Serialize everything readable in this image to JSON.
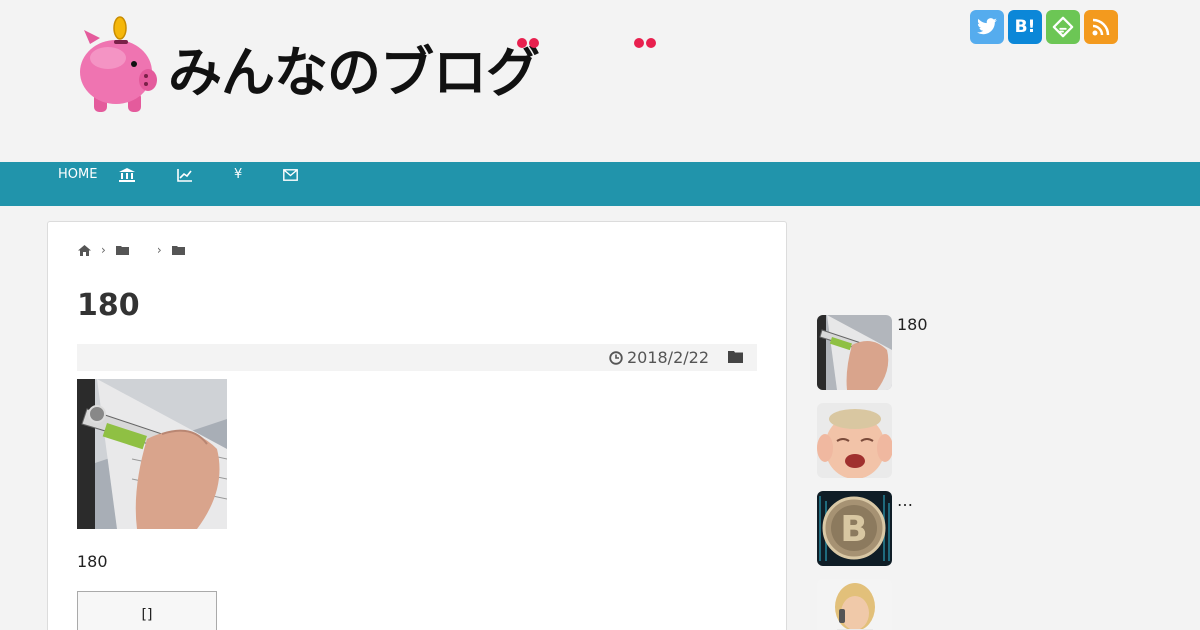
{
  "header": {
    "logo_text": "みんなのブログ",
    "social": [
      {
        "name": "twitter-icon",
        "glyph": "",
        "color": "#55acee"
      },
      {
        "name": "hatena-bookmark-icon",
        "glyph": "B!",
        "color": "#0b87d8"
      },
      {
        "name": "feedly-icon",
        "glyph": "",
        "color": "#6cc655"
      },
      {
        "name": "rss-icon",
        "glyph": "",
        "color": "#f39a1e"
      }
    ]
  },
  "nav": {
    "home_label": "HOME",
    "yen_label": "¥"
  },
  "article": {
    "title": "180",
    "date": "2018/2/22",
    "caption": "180",
    "button_label": "[]"
  },
  "sidebar": {
    "items": [
      {
        "label": "180"
      },
      {
        "label": ""
      },
      {
        "label": "…"
      },
      {
        "label": ""
      }
    ]
  },
  "colors": {
    "nav_bg": "#2194ab",
    "page_bg": "#f3f3f3",
    "accent_dot": "#e8204e"
  }
}
